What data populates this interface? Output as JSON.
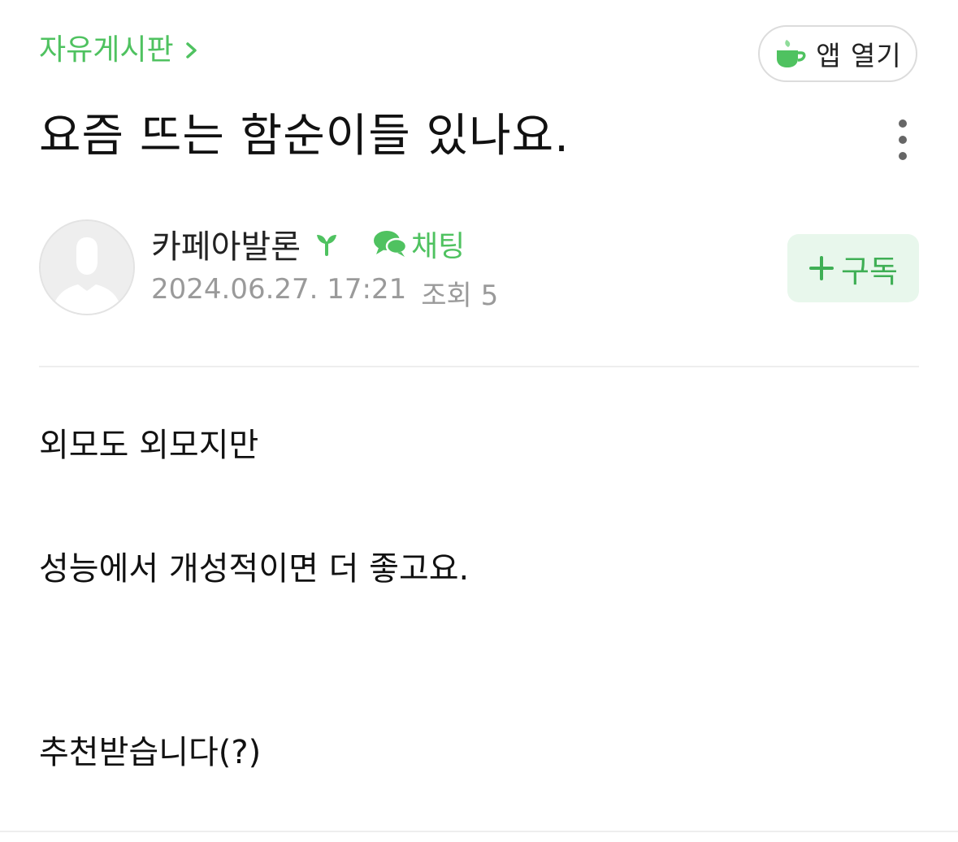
{
  "header": {
    "board_name": "자유게시판",
    "app_open_label": "앱 열기"
  },
  "post": {
    "title": "요즘 뜨는 함순이들 있나요.",
    "author": {
      "name": "카페아발론",
      "chat_label": "채팅",
      "date": "2024.06.27. 17:21",
      "views": "조회 5"
    },
    "subscribe_label": "구독",
    "body": [
      "외모도 외모지만",
      "성능에서 개성적이면 더 좋고요.",
      "추천받습니다(?)"
    ]
  },
  "colors": {
    "accent": "#4fc260",
    "subscribe_bg": "#e8f7ec",
    "meta_text": "#9a9a9a"
  },
  "icons": {
    "board_chevron": "chevron-right-icon",
    "app": "cafe-cup-icon",
    "more": "more-vertical-icon",
    "level": "sprout-icon",
    "chat": "chat-bubbles-icon",
    "subscribe": "plus-icon",
    "avatar": "default-profile-icon"
  }
}
